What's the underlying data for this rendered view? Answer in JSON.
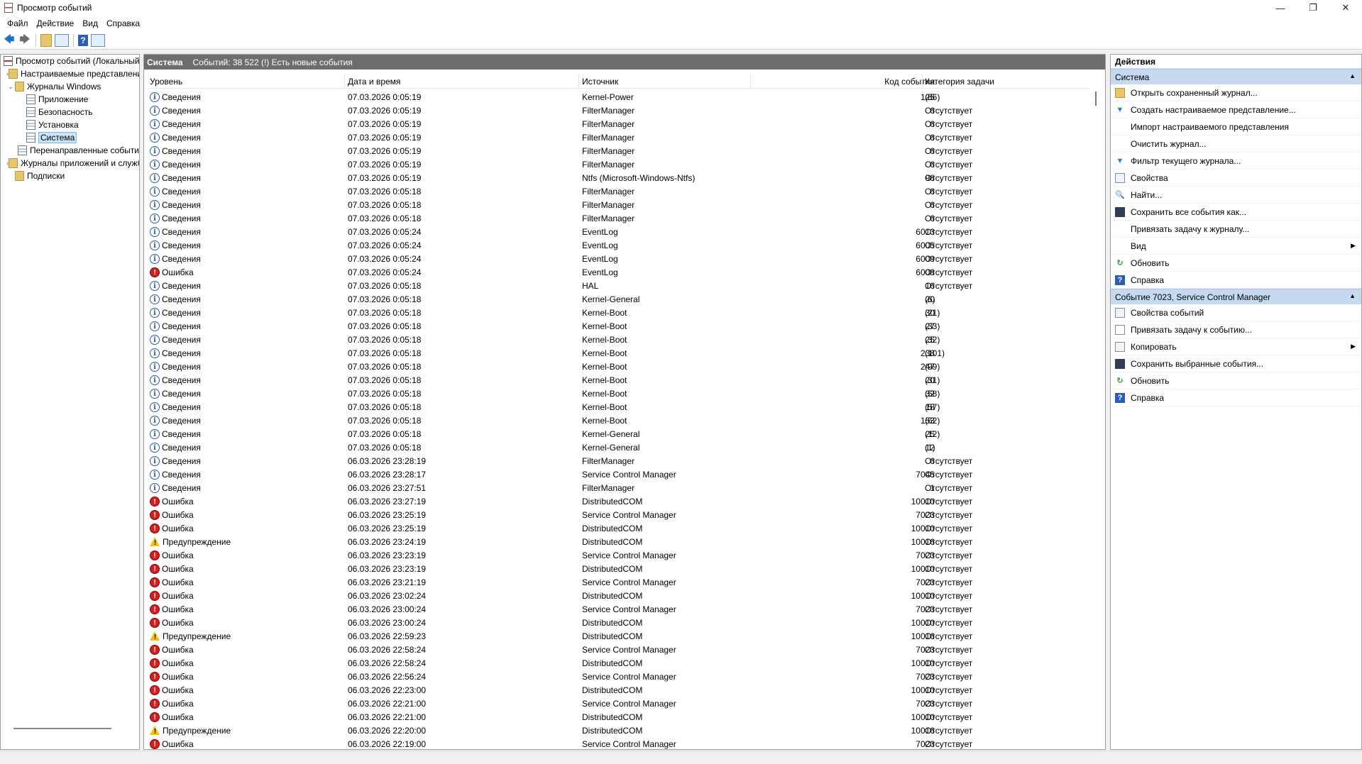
{
  "window": {
    "title": "Просмотр событий",
    "controls": {
      "minimize": "—",
      "restore": "❐",
      "close": "✕"
    }
  },
  "menu": [
    "Файл",
    "Действие",
    "Вид",
    "Справка"
  ],
  "tree": {
    "items": [
      {
        "label": "Просмотр событий (Локальный)",
        "depth": 0,
        "expander": "",
        "icon": "event-viewer-icon",
        "selected": false
      },
      {
        "label": "Настраиваемые представления",
        "depth": 1,
        "expander": "›",
        "icon": "folder-icon",
        "selected": false
      },
      {
        "label": "Журналы Windows",
        "depth": 1,
        "expander": "⌄",
        "icon": "folder-icon",
        "selected": false
      },
      {
        "label": "Приложение",
        "depth": 2,
        "expander": "",
        "icon": "log-icon",
        "selected": false
      },
      {
        "label": "Безопасность",
        "depth": 2,
        "expander": "",
        "icon": "log-icon",
        "selected": false
      },
      {
        "label": "Установка",
        "depth": 2,
        "expander": "",
        "icon": "log-icon",
        "selected": false
      },
      {
        "label": "Система",
        "depth": 2,
        "expander": "",
        "icon": "log-icon",
        "selected": true
      },
      {
        "label": "Перенаправленные события",
        "depth": 2,
        "expander": "",
        "icon": "log-icon",
        "selected": false
      },
      {
        "label": "Журналы приложений и служб",
        "depth": 1,
        "expander": "›",
        "icon": "folder-icon",
        "selected": false
      },
      {
        "label": "Подписки",
        "depth": 1,
        "expander": "",
        "icon": "folder-icon",
        "selected": false
      }
    ]
  },
  "center": {
    "log_name": "Система",
    "summary": "Событий: 38 522 (!) Есть новые события",
    "columns": {
      "level": "Уровень",
      "datetime": "Дата и время",
      "source": "Источник",
      "event_id": "Код события",
      "category": "Категория задачи"
    },
    "rows": [
      [
        "info",
        "Сведения",
        "07.03.2026 0:05:19",
        "Kernel-Power",
        "125",
        "(86)"
      ],
      [
        "info",
        "Сведения",
        "07.03.2026 0:05:19",
        "FilterManager",
        "6",
        "Отсутствует"
      ],
      [
        "info",
        "Сведения",
        "07.03.2026 0:05:19",
        "FilterManager",
        "6",
        "Отсутствует"
      ],
      [
        "info",
        "Сведения",
        "07.03.2026 0:05:19",
        "FilterManager",
        "6",
        "Отсутствует"
      ],
      [
        "info",
        "Сведения",
        "07.03.2026 0:05:19",
        "FilterManager",
        "6",
        "Отсутствует"
      ],
      [
        "info",
        "Сведения",
        "07.03.2026 0:05:19",
        "FilterManager",
        "6",
        "Отсутствует"
      ],
      [
        "info",
        "Сведения",
        "07.03.2026 0:05:19",
        "Ntfs (Microsoft-Windows-Ntfs)",
        "98",
        "Отсутствует"
      ],
      [
        "info",
        "Сведения",
        "07.03.2026 0:05:18",
        "FilterManager",
        "6",
        "Отсутствует"
      ],
      [
        "info",
        "Сведения",
        "07.03.2026 0:05:18",
        "FilterManager",
        "6",
        "Отсутствует"
      ],
      [
        "info",
        "Сведения",
        "07.03.2026 0:05:18",
        "FilterManager",
        "6",
        "Отсутствует"
      ],
      [
        "info",
        "Сведения",
        "07.03.2026 0:05:24",
        "EventLog",
        "6013",
        "Отсутствует"
      ],
      [
        "info",
        "Сведения",
        "07.03.2026 0:05:24",
        "EventLog",
        "6005",
        "Отсутствует"
      ],
      [
        "info",
        "Сведения",
        "07.03.2026 0:05:24",
        "EventLog",
        "6009",
        "Отсутствует"
      ],
      [
        "error",
        "Ошибка",
        "07.03.2026 0:05:24",
        "EventLog",
        "6008",
        "Отсутствует"
      ],
      [
        "info",
        "Сведения",
        "07.03.2026 0:05:18",
        "HAL",
        "16",
        "Отсутствует"
      ],
      [
        "info",
        "Сведения",
        "07.03.2026 0:05:18",
        "Kernel-General",
        "20",
        "(6)"
      ],
      [
        "info",
        "Сведения",
        "07.03.2026 0:05:18",
        "Kernel-Boot",
        "30",
        "(21)"
      ],
      [
        "info",
        "Сведения",
        "07.03.2026 0:05:18",
        "Kernel-Boot",
        "27",
        "(33)"
      ],
      [
        "info",
        "Сведения",
        "07.03.2026 0:05:18",
        "Kernel-Boot",
        "25",
        "(32)"
      ],
      [
        "info",
        "Сведения",
        "07.03.2026 0:05:18",
        "Kernel-Boot",
        "238",
        "(101)"
      ],
      [
        "info",
        "Сведения",
        "07.03.2026 0:05:18",
        "Kernel-Boot",
        "247",
        "(99)"
      ],
      [
        "info",
        "Сведения",
        "07.03.2026 0:05:18",
        "Kernel-Boot",
        "20",
        "(31)"
      ],
      [
        "info",
        "Сведения",
        "07.03.2026 0:05:18",
        "Kernel-Boot",
        "32",
        "(58)"
      ],
      [
        "info",
        "Сведения",
        "07.03.2026 0:05:18",
        "Kernel-Boot",
        "18",
        "(57)"
      ],
      [
        "info",
        "Сведения",
        "07.03.2026 0:05:18",
        "Kernel-Boot",
        "153",
        "(62)"
      ],
      [
        "info",
        "Сведения",
        "07.03.2026 0:05:18",
        "Kernel-General",
        "25",
        "(12)"
      ],
      [
        "info",
        "Сведения",
        "07.03.2026 0:05:18",
        "Kernel-General",
        "12",
        "(1)"
      ],
      [
        "info",
        "Сведения",
        "06.03.2026 23:28:19",
        "FilterManager",
        "6",
        "Отсутствует"
      ],
      [
        "info",
        "Сведения",
        "06.03.2026 23:28:17",
        "Service Control Manager",
        "7045",
        "Отсутствует"
      ],
      [
        "info",
        "Сведения",
        "06.03.2026 23:27:51",
        "FilterManager",
        "1",
        "Отсутствует"
      ],
      [
        "error",
        "Ошибка",
        "06.03.2026 23:27:19",
        "DistributedCOM",
        "10010",
        "Отсутствует"
      ],
      [
        "error",
        "Ошибка",
        "06.03.2026 23:25:19",
        "Service Control Manager",
        "7023",
        "Отсутствует"
      ],
      [
        "error",
        "Ошибка",
        "06.03.2026 23:25:19",
        "DistributedCOM",
        "10010",
        "Отсутствует"
      ],
      [
        "warn",
        "Предупреждение",
        "06.03.2026 23:24:19",
        "DistributedCOM",
        "10016",
        "Отсутствует"
      ],
      [
        "error",
        "Ошибка",
        "06.03.2026 23:23:19",
        "Service Control Manager",
        "7023",
        "Отсутствует"
      ],
      [
        "error",
        "Ошибка",
        "06.03.2026 23:23:19",
        "DistributedCOM",
        "10010",
        "Отсутствует"
      ],
      [
        "error",
        "Ошибка",
        "06.03.2026 23:21:19",
        "Service Control Manager",
        "7023",
        "Отсутствует"
      ],
      [
        "error",
        "Ошибка",
        "06.03.2026 23:02:24",
        "DistributedCOM",
        "10010",
        "Отсутствует"
      ],
      [
        "error",
        "Ошибка",
        "06.03.2026 23:00:24",
        "Service Control Manager",
        "7023",
        "Отсутствует"
      ],
      [
        "error",
        "Ошибка",
        "06.03.2026 23:00:24",
        "DistributedCOM",
        "10010",
        "Отсутствует"
      ],
      [
        "warn",
        "Предупреждение",
        "06.03.2026 22:59:23",
        "DistributedCOM",
        "10016",
        "Отсутствует"
      ],
      [
        "error",
        "Ошибка",
        "06.03.2026 22:58:24",
        "Service Control Manager",
        "7023",
        "Отсутствует"
      ],
      [
        "error",
        "Ошибка",
        "06.03.2026 22:58:24",
        "DistributedCOM",
        "10010",
        "Отсутствует"
      ],
      [
        "error",
        "Ошибка",
        "06.03.2026 22:56:24",
        "Service Control Manager",
        "7023",
        "Отсутствует"
      ],
      [
        "error",
        "Ошибка",
        "06.03.2026 22:23:00",
        "DistributedCOM",
        "10010",
        "Отсутствует"
      ],
      [
        "error",
        "Ошибка",
        "06.03.2026 22:21:00",
        "Service Control Manager",
        "7023",
        "Отсутствует"
      ],
      [
        "error",
        "Ошибка",
        "06.03.2026 22:21:00",
        "DistributedCOM",
        "10010",
        "Отсутствует"
      ],
      [
        "warn",
        "Предупреждение",
        "06.03.2026 22:20:00",
        "DistributedCOM",
        "10016",
        "Отсутствует"
      ],
      [
        "error",
        "Ошибка",
        "06.03.2026 22:19:00",
        "Service Control Manager",
        "7023",
        "Отсутствует"
      ]
    ]
  },
  "actions": {
    "title": "Действия",
    "sections": [
      {
        "header": "Система",
        "items": [
          {
            "label": "Открыть сохраненный журнал...",
            "icon": "open-folder-icon",
            "submenu": false
          },
          {
            "label": "Создать настраиваемое представление...",
            "icon": "filter-icon",
            "submenu": false
          },
          {
            "label": "Импорт настраиваемого представления",
            "icon": "",
            "submenu": false
          },
          {
            "label": "Очистить журнал...",
            "icon": "",
            "submenu": false
          },
          {
            "label": "Фильтр текущего журнала...",
            "icon": "filter-icon",
            "submenu": false
          },
          {
            "label": "Свойства",
            "icon": "properties-icon",
            "submenu": false
          },
          {
            "label": "Найти...",
            "icon": "find-icon",
            "submenu": false
          },
          {
            "label": "Сохранить все события как...",
            "icon": "save-icon",
            "submenu": false
          },
          {
            "label": "Привязать задачу к журналу...",
            "icon": "",
            "submenu": false
          },
          {
            "label": "Вид",
            "icon": "",
            "submenu": true
          },
          {
            "label": "Обновить",
            "icon": "refresh-icon",
            "submenu": false
          },
          {
            "label": "Справка",
            "icon": "help-icon",
            "submenu": false
          }
        ]
      },
      {
        "header": "Событие 7023, Service Control Manager",
        "items": [
          {
            "label": "Свойства событий",
            "icon": "properties-icon",
            "submenu": false
          },
          {
            "label": "Привязать задачу к событию...",
            "icon": "task-icon",
            "submenu": false
          },
          {
            "label": "Копировать",
            "icon": "copy-icon",
            "submenu": true
          },
          {
            "label": "Сохранить выбранные события...",
            "icon": "save-icon",
            "submenu": false
          },
          {
            "label": "Обновить",
            "icon": "refresh-icon",
            "submenu": false
          },
          {
            "label": "Справка",
            "icon": "help-icon",
            "submenu": false
          }
        ]
      }
    ]
  }
}
